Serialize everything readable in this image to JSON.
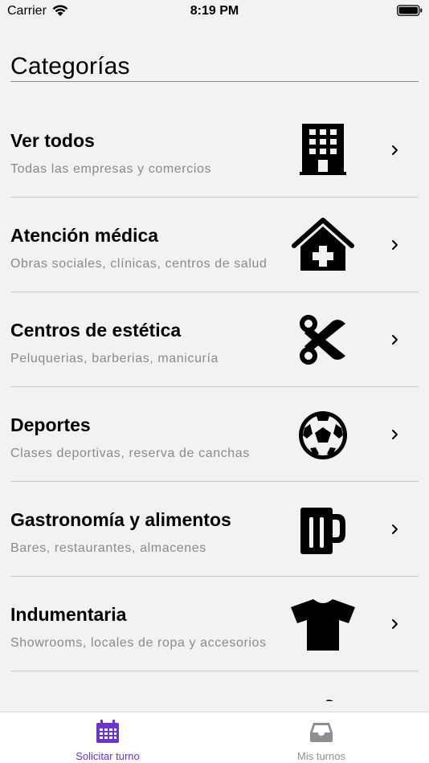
{
  "status_bar": {
    "carrier": "Carrier",
    "time": "8:19 PM"
  },
  "header": {
    "title": "Categorías"
  },
  "categories": [
    {
      "title": "Ver todos",
      "subtitle": "Todas las empresas y comercios",
      "icon": "building-icon"
    },
    {
      "title": "Atención médica",
      "subtitle": "Obras sociales, clínicas, centros de salud",
      "icon": "clinic-icon"
    },
    {
      "title": "Centros de estética",
      "subtitle": "Peluquerias, barberias, manicuría",
      "icon": "scissors-icon"
    },
    {
      "title": "Deportes",
      "subtitle": "Clases deportivas, reserva de canchas",
      "icon": "soccer-ball-icon"
    },
    {
      "title": "Gastronomía y alimentos",
      "subtitle": "Bares, restaurantes, almacenes",
      "icon": "beer-mug-icon"
    },
    {
      "title": "Indumentaria",
      "subtitle": "Showrooms, locales de ropa y accesorios",
      "icon": "tshirt-icon"
    }
  ],
  "tab_bar": {
    "tabs": [
      {
        "label": "Solicitar turno",
        "icon": "calendar-icon",
        "active": true
      },
      {
        "label": "Mis turnos",
        "icon": "inbox-icon",
        "active": false
      }
    ]
  },
  "colors": {
    "accent": "#6a35c9",
    "inactive": "#8e8e93",
    "background": "#f2f2f2"
  }
}
